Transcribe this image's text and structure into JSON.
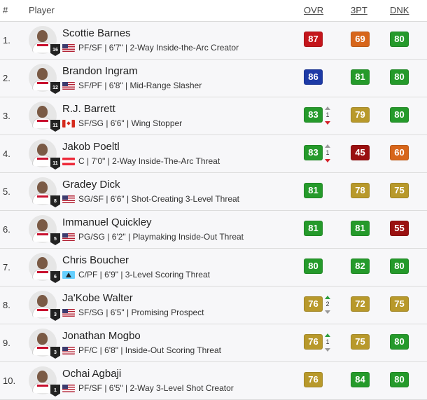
{
  "header": {
    "num": "#",
    "player": "Player",
    "ovr": "OVR",
    "tpt": "3PT",
    "dnk": "DNK"
  },
  "colors": {
    "red": "#b3161b",
    "navy": "#1d3ca3",
    "green": "#279a2c",
    "darkgreen": "#1f7d23",
    "gold": "#b39a2e",
    "orange": "#d56c16",
    "olive": "#9a8c1a",
    "maroon": "#941212"
  },
  "players": [
    {
      "rank": "1.",
      "name": "Scottie Barnes",
      "jersey": "16",
      "flag": "us",
      "info": "PF/SF | 6'7\" | 2-Way Inside-the-Arc Creator",
      "ovr": "87",
      "ovr_color": "#c4161c",
      "tpt": "69",
      "tpt_color": "#d7661b",
      "dnk": "80",
      "dnk_color": "#259a2b",
      "change": null,
      "change_dir": null
    },
    {
      "rank": "2.",
      "name": "Brandon Ingram",
      "jersey": "12",
      "flag": "us",
      "info": "SF/PF | 6'8\" | Mid-Range Slasher",
      "ovr": "86",
      "ovr_color": "#1d3aa6",
      "tpt": "81",
      "tpt_color": "#259a2b",
      "dnk": "80",
      "dnk_color": "#259a2b",
      "change": null,
      "change_dir": null
    },
    {
      "rank": "3.",
      "name": "R.J. Barrett",
      "jersey": "11",
      "flag": "ca",
      "info": "SF/SG | 6'6\" | Wing Stopper",
      "ovr": "83",
      "ovr_color": "#259a2b",
      "tpt": "79",
      "tpt_color": "#b8992b",
      "dnk": "80",
      "dnk_color": "#259a2b",
      "change": "1",
      "change_dir": "down"
    },
    {
      "rank": "4.",
      "name": "Jakob Poeltl",
      "jersey": "11",
      "flag": "at",
      "info": "C | 7'0\" | 2-Way Inside-The-Arc Threat",
      "ovr": "83",
      "ovr_color": "#259a2b",
      "tpt": "45",
      "tpt_color": "#9a1010",
      "dnk": "60",
      "dnk_color": "#d7661b",
      "change": "1",
      "change_dir": "down"
    },
    {
      "rank": "5.",
      "name": "Gradey Dick",
      "jersey": "8",
      "flag": "us",
      "info": "SG/SF | 6'6\" | Shot-Creating 3-Level Threat",
      "ovr": "81",
      "ovr_color": "#259a2b",
      "tpt": "78",
      "tpt_color": "#b8992b",
      "dnk": "75",
      "dnk_color": "#b8992b",
      "change": null,
      "change_dir": null
    },
    {
      "rank": "6.",
      "name": "Immanuel Quickley",
      "jersey": "5",
      "flag": "us",
      "info": "PG/SG | 6'2\" | Playmaking Inside-Out Threat",
      "ovr": "81",
      "ovr_color": "#259a2b",
      "tpt": "81",
      "tpt_color": "#259a2b",
      "dnk": "55",
      "dnk_color": "#9a1010",
      "change": null,
      "change_dir": null
    },
    {
      "rank": "7.",
      "name": "Chris Boucher",
      "jersey": "6",
      "flag": "lc",
      "info": "C/PF | 6'9\" | 3-Level Scoring Threat",
      "ovr": "80",
      "ovr_color": "#259a2b",
      "tpt": "82",
      "tpt_color": "#259a2b",
      "dnk": "80",
      "dnk_color": "#259a2b",
      "change": null,
      "change_dir": null
    },
    {
      "rank": "8.",
      "name": "Ja'Kobe Walter",
      "jersey": "3",
      "flag": "us",
      "info": "SF/SG | 6'5\" | Promising Prospect",
      "ovr": "76",
      "ovr_color": "#b8992b",
      "tpt": "72",
      "tpt_color": "#b8992b",
      "dnk": "75",
      "dnk_color": "#b8992b",
      "change": "2",
      "change_dir": "up"
    },
    {
      "rank": "9.",
      "name": "Jonathan Mogbo",
      "jersey": "3",
      "flag": "us",
      "info": "PF/C | 6'8\" | Inside-Out Scoring Threat",
      "ovr": "76",
      "ovr_color": "#b8992b",
      "tpt": "75",
      "tpt_color": "#b8992b",
      "dnk": "80",
      "dnk_color": "#259a2b",
      "change": "1",
      "change_dir": "up"
    },
    {
      "rank": "10.",
      "name": "Ochai Agbaji",
      "jersey": "1",
      "flag": "us",
      "info": "PF/SF | 6'5\" | 2-Way 3-Level Shot Creator",
      "ovr": "76",
      "ovr_color": "#b8992b",
      "tpt": "84",
      "tpt_color": "#259a2b",
      "dnk": "80",
      "dnk_color": "#259a2b",
      "change": null,
      "change_dir": null
    }
  ]
}
